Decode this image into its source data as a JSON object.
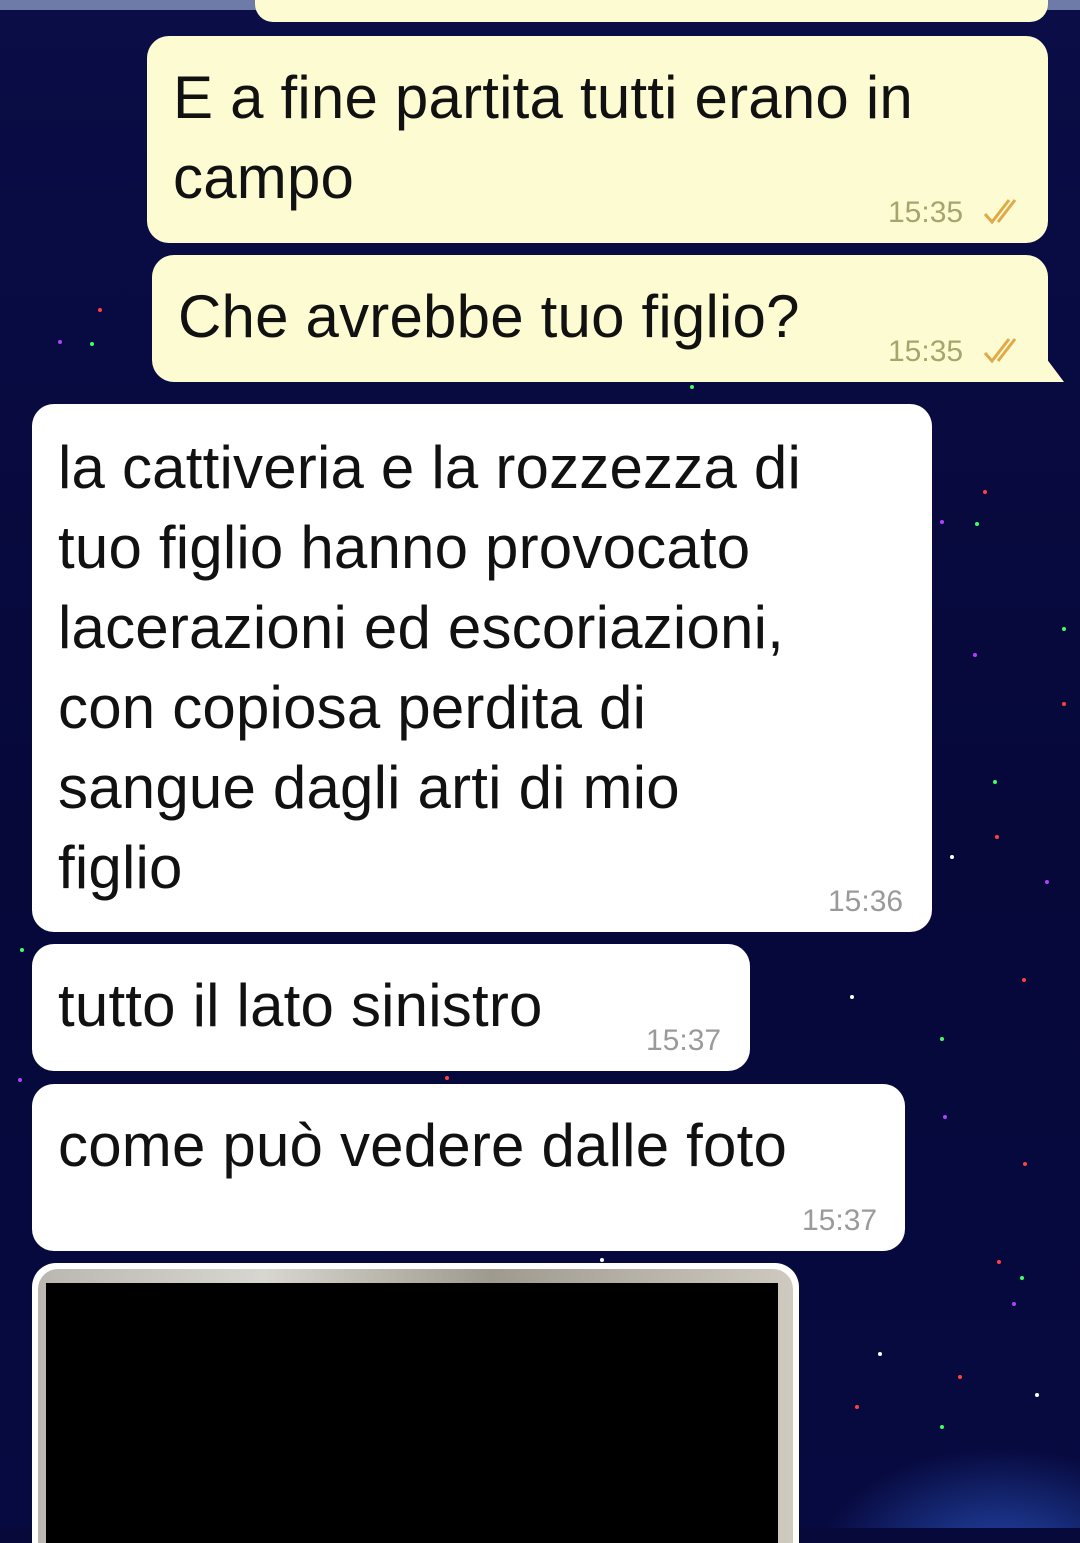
{
  "chat": {
    "messages": [
      {
        "direction": "outgoing",
        "text": "E a fine partita tutti erano in\ncampo",
        "time": "15:35",
        "status_icon": "double-check-read-icon"
      },
      {
        "direction": "outgoing",
        "text": "Che avrebbe tuo figlio?",
        "time": "15:35",
        "status_icon": "double-check-read-icon"
      },
      {
        "direction": "incoming",
        "text": "la cattiveria e la rozzezza di\ntuo figlio hanno provocato\nlacerazioni ed escoriazioni,\ncon copiosa perdita di\nsangue dagli arti di mio\nfiglio",
        "time": "15:36"
      },
      {
        "direction": "incoming",
        "text": "tutto il lato sinistro",
        "time": "15:37"
      },
      {
        "direction": "incoming",
        "text": "come può vedere dalle foto",
        "time": "15:37"
      },
      {
        "direction": "incoming",
        "type": "photo",
        "redacted": true
      }
    ]
  },
  "colors": {
    "outgoing_bubble": "#fdfbd2",
    "incoming_bubble": "#ffffff",
    "background": "#07093a",
    "read_ticks": "#e0a94a"
  }
}
